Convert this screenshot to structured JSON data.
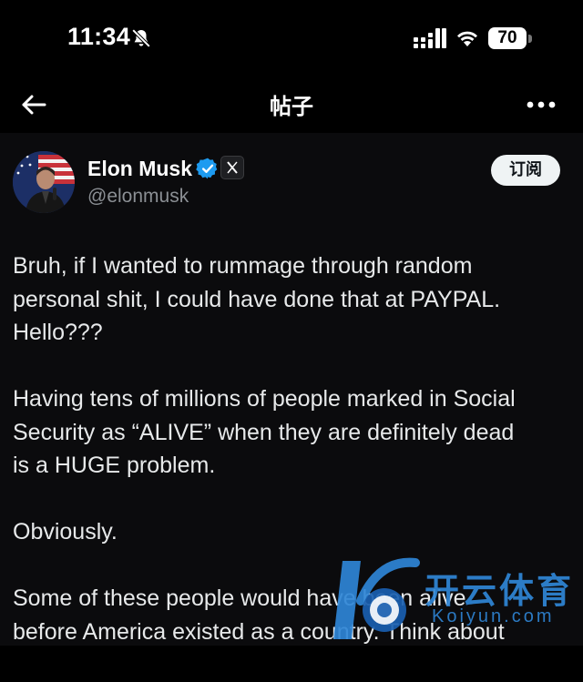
{
  "status_bar": {
    "time": "11:34",
    "battery": "70"
  },
  "header": {
    "title": "帖子"
  },
  "post": {
    "author_name": "Elon Musk",
    "handle": "@elonmusk",
    "subscribe_label": "订阅",
    "paragraphs": [
      "Bruh, if I wanted to rummage through random\npersonal shit, I could have done that at PAYPAL.\nHello???",
      "Having tens of millions of people marked in Social\nSecurity as “ALIVE” when they are definitely dead\nis a HUGE problem.",
      "Obviously.",
      "Some of these people would have been alive\nbefore America existed as a country. Think about"
    ]
  },
  "watermark": {
    "text": "开云体育",
    "sub": "Koiyun.com"
  },
  "colors": {
    "background": "#000000",
    "panel": "#0b0b0d",
    "text": "#e7e9ea",
    "secondary_text": "#8b8f94",
    "verified_blue": "#1d9bf0",
    "watermark_blue": "#2f86d6"
  },
  "icons": {
    "status": [
      "bell-slash-icon",
      "signal-icon",
      "wifi-icon",
      "battery-icon"
    ],
    "nav": [
      "back-arrow-icon",
      "more-dots-icon"
    ],
    "badges": [
      "verified-badge-icon",
      "x-affiliate-icon"
    ]
  }
}
